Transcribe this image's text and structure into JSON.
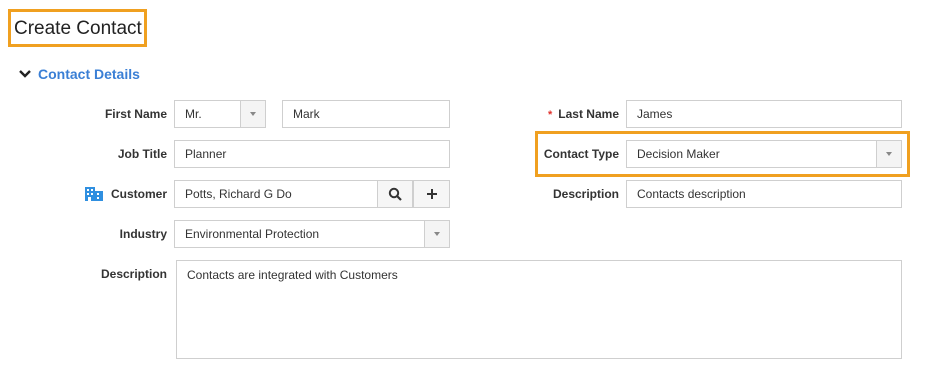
{
  "page": {
    "title": "Create Contact",
    "section_title": "Contact Details"
  },
  "form": {
    "first_name": {
      "label": "First Name",
      "salutation": "Mr.",
      "value": "Mark"
    },
    "last_name": {
      "label": "Last Name",
      "required_marker": "*",
      "value": "James"
    },
    "job_title": {
      "label": "Job Title",
      "value": "Planner"
    },
    "contact_type": {
      "label": "Contact Type",
      "value": "Decision Maker"
    },
    "customer": {
      "label": "Customer",
      "value": "Potts, Richard G Do",
      "icon": "building-icon"
    },
    "description_short": {
      "label": "Description",
      "value": "Contacts description"
    },
    "industry": {
      "label": "Industry",
      "value": "Environmental Protection"
    },
    "description_long": {
      "label": "Description",
      "value": "Contacts are integrated with Customers"
    }
  },
  "colors": {
    "accent": "#3a7fd5",
    "highlight": "#f0a020",
    "required": "#e0302a"
  }
}
